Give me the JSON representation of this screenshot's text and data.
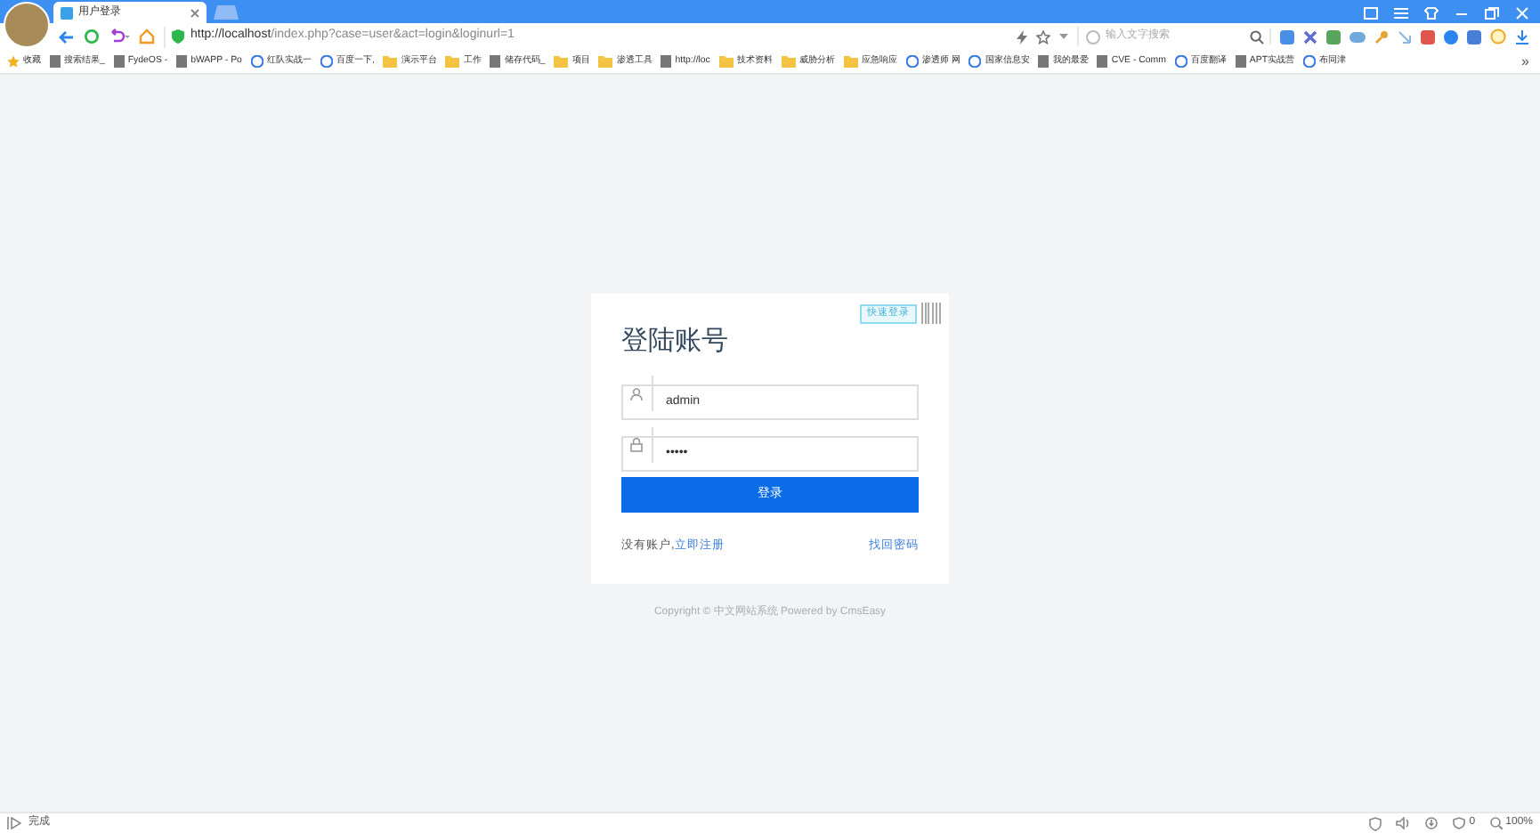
{
  "browser": {
    "tab": {
      "title": "用户登录",
      "selected": true
    },
    "url": {
      "host": "http://localhost",
      "path": "/index.php?case=user&act=login&loginurl=1"
    },
    "search": {
      "placeholder": "输入文字搜索"
    },
    "bookmarks": [
      {
        "label": "收藏",
        "kind": "star"
      },
      {
        "label": "搜索结果_",
        "kind": "page"
      },
      {
        "label": "FydeOS -",
        "kind": "page"
      },
      {
        "label": "bWAPP - Po",
        "kind": "page"
      },
      {
        "label": "红队实战一",
        "kind": "globe"
      },
      {
        "label": "百度一下,",
        "kind": "globe"
      },
      {
        "label": "演示平台",
        "kind": "folder"
      },
      {
        "label": "工作",
        "kind": "folder"
      },
      {
        "label": "储存代码_",
        "kind": "page"
      },
      {
        "label": "项目",
        "kind": "folder"
      },
      {
        "label": "渗透工具",
        "kind": "folder"
      },
      {
        "label": "http://loc",
        "kind": "page"
      },
      {
        "label": "技术资料",
        "kind": "folder"
      },
      {
        "label": "威胁分析",
        "kind": "folder"
      },
      {
        "label": "应急响应",
        "kind": "folder"
      },
      {
        "label": "渗透师 网",
        "kind": "globe"
      },
      {
        "label": "国家信息安",
        "kind": "globe"
      },
      {
        "label": "我的最爱",
        "kind": "page"
      },
      {
        "label": "CVE - Comm",
        "kind": "page"
      },
      {
        "label": "百度翻译",
        "kind": "globe"
      },
      {
        "label": "APT实战营",
        "kind": "page"
      },
      {
        "label": "布同津",
        "kind": "globe"
      }
    ],
    "more": "»"
  },
  "login": {
    "badge": "快速登录",
    "title": "登陆账号",
    "username": {
      "value": "admin"
    },
    "password": {
      "value": "•••••"
    },
    "submit": "登录",
    "register_prompt": "没有账户,",
    "register_link": "立即注册",
    "forgot_link": "找回密码"
  },
  "copyright": "Copyright © 中文网站系统 Powered by CmsEasy",
  "status_bar": {
    "status": "完成",
    "blocked": "0",
    "zoom": "100%"
  }
}
